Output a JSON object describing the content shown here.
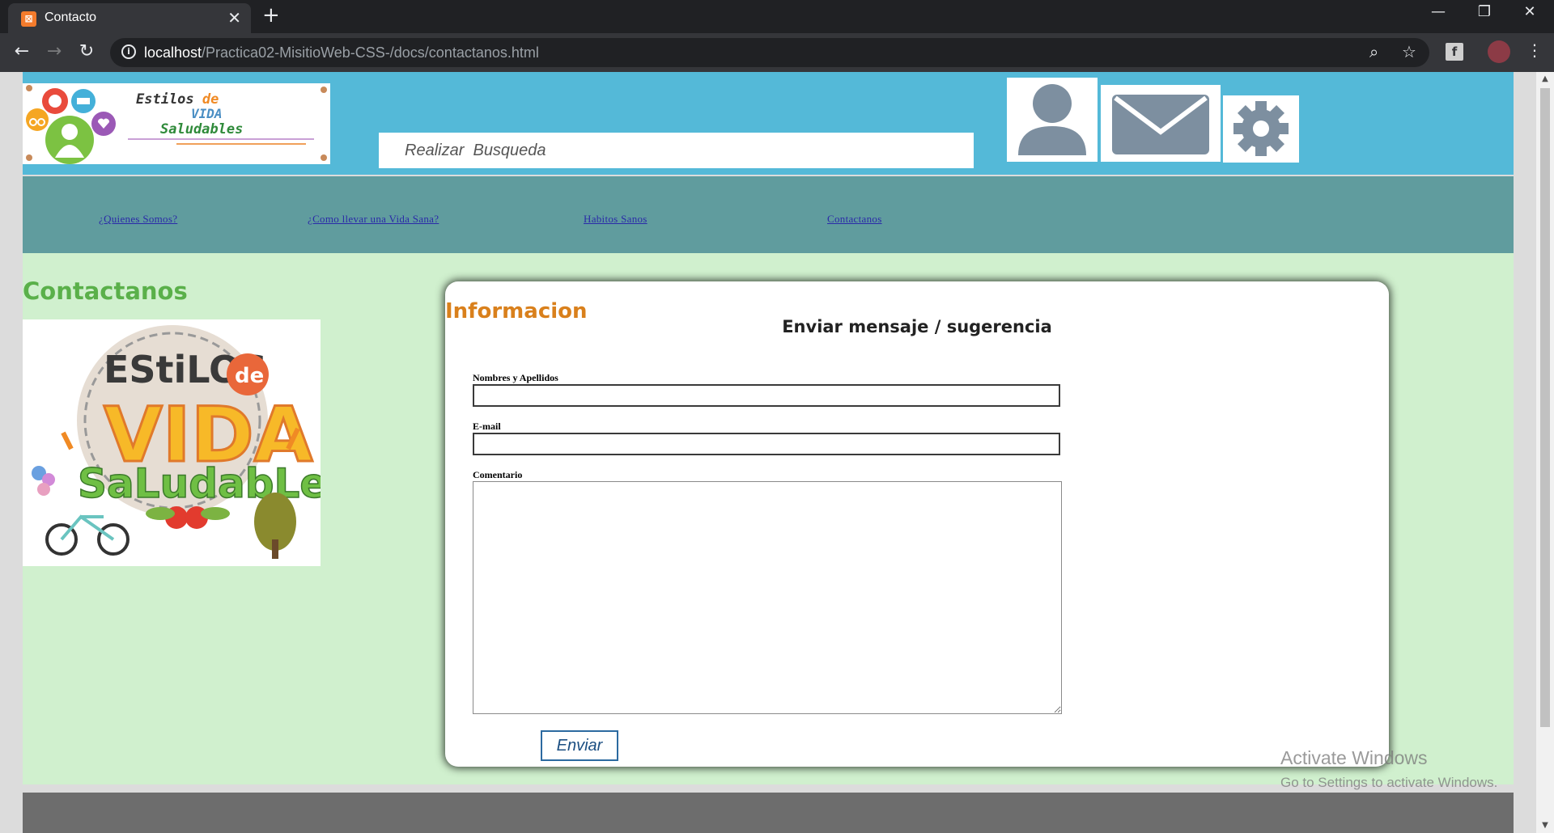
{
  "browser": {
    "tab_title": "Contacto",
    "url_host": "localhost",
    "url_path": "/Practica02-MisitioWeb-CSS-/docs/contactanos.html",
    "window_controls": {
      "minimize": "—",
      "restore": "❐",
      "close": "✕"
    }
  },
  "header": {
    "logo": {
      "line1_a": "Estilos ",
      "line1_b": "de",
      "line2": "VIDA",
      "line3": "Saludables"
    },
    "search_placeholder": "Realizar  Busqueda",
    "icons": [
      "user-icon",
      "mail-icon",
      "gear-icon"
    ]
  },
  "nav": {
    "items": [
      {
        "label": "¿Quienes Somos?"
      },
      {
        "label": "¿Como llevar una Vida Sana?"
      },
      {
        "label": "Habitos Sanos"
      },
      {
        "label": "Contactanos"
      }
    ]
  },
  "main": {
    "left_title": "Contactanos",
    "image": {
      "line1": "EStiLOS",
      "line2": "de",
      "line3": "VIDA",
      "line4": "SaLudabLeS"
    },
    "card": {
      "title": "Informacion",
      "heading": "Enviar mensaje / sugerencia",
      "fields": [
        {
          "label": "Nombres y Apellidos",
          "value": ""
        },
        {
          "label": "E-mail",
          "value": ""
        },
        {
          "label": "Comentario",
          "value": ""
        }
      ],
      "submit_label": "Enviar"
    }
  },
  "watermark": {
    "line1": "Activate Windows",
    "line2": "Go to Settings to activate Windows."
  },
  "colors": {
    "header_bg": "#54b9d8",
    "nav_bg": "#609c9e",
    "content_bg": "#d0f0ce",
    "title_green": "#5ab04a",
    "title_orange": "#d9801c"
  }
}
